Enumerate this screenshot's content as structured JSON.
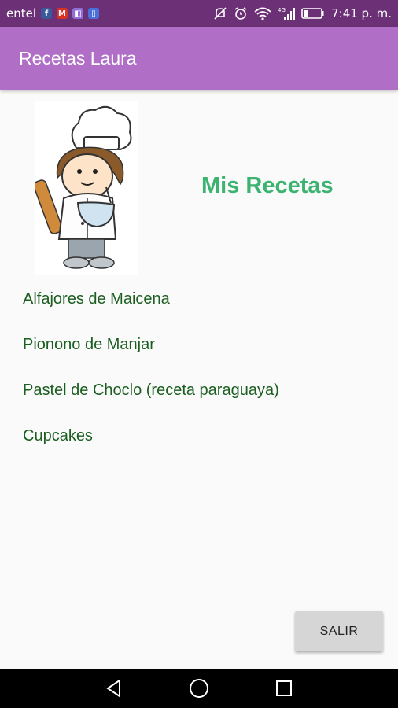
{
  "status_bar": {
    "carrier": "entel",
    "time": "7:41 p. m.",
    "notification_icons": [
      "facebook-icon",
      "gmail-icon",
      "app-icon",
      "phone-icon"
    ],
    "status_icons": [
      "mute-icon",
      "alarm-icon",
      "wifi-icon",
      "signal-4g-icon",
      "battery-icon"
    ]
  },
  "app_bar": {
    "title": "Recetas Laura"
  },
  "main": {
    "heading": "Mis Recetas",
    "image": "chef-illustration",
    "recipes": [
      "Alfajores de Maicena",
      "Pionono de Manjar",
      "Pastel de Choclo (receta paraguaya)",
      "Cupcakes"
    ],
    "exit_label": "SALIR"
  },
  "nav_bar": {
    "buttons": [
      "back-icon",
      "home-icon",
      "recents-icon"
    ]
  },
  "colors": {
    "status_bar": "#6b3075",
    "app_bar": "#b06ec7",
    "heading": "#3cb371",
    "recipe_text": "#1b5e20",
    "button": "#d6d6d6"
  }
}
